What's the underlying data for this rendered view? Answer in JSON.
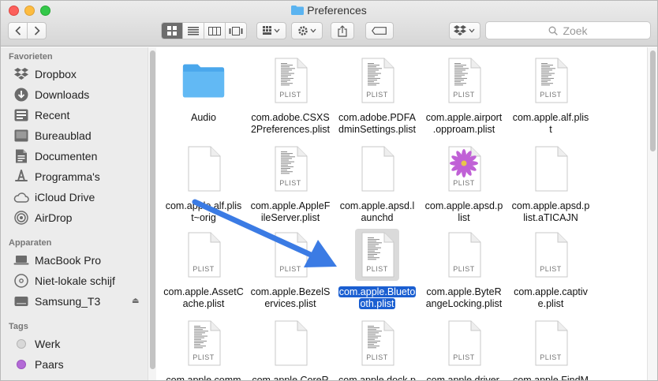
{
  "window": {
    "title": "Preferences"
  },
  "toolbar": {
    "search_placeholder": "Zoek"
  },
  "sidebar": {
    "sections": [
      {
        "label": "Favorieten",
        "items": [
          {
            "label": "Dropbox",
            "icon": "dropbox-icon"
          },
          {
            "label": "Downloads",
            "icon": "download-icon"
          },
          {
            "label": "Recent",
            "icon": "clock-icon"
          },
          {
            "label": "Bureaublad",
            "icon": "desktop-icon"
          },
          {
            "label": "Documenten",
            "icon": "document-icon"
          },
          {
            "label": "Programma's",
            "icon": "applications-icon"
          },
          {
            "label": "iCloud Drive",
            "icon": "cloud-icon"
          },
          {
            "label": "AirDrop",
            "icon": "airdrop-icon"
          }
        ]
      },
      {
        "label": "Apparaten",
        "items": [
          {
            "label": "MacBook Pro",
            "icon": "laptop-icon"
          },
          {
            "label": "Niet-lokale schijf",
            "icon": "disc-icon"
          },
          {
            "label": "Samsung_T3",
            "icon": "drive-icon"
          }
        ]
      },
      {
        "label": "Tags",
        "items": [
          {
            "label": "Werk",
            "color": "#d8d8d8"
          },
          {
            "label": "Paars",
            "color": "#b36ad6"
          }
        ]
      }
    ]
  },
  "files": [
    {
      "line1": "Audio",
      "line2": "",
      "kind": "folder"
    },
    {
      "line1": "com.adobe.CSXS",
      "line2": "2Preferences.plist",
      "kind": "plist-text"
    },
    {
      "line1": "com.adobe.PDFA",
      "line2": "dminSettings.plist",
      "kind": "plist-text"
    },
    {
      "line1": "com.apple.airport",
      "line2": ".opproam.plist",
      "kind": "plist-text"
    },
    {
      "line1": "com.apple.alf.plis",
      "line2": "t",
      "kind": "plist-text"
    },
    {
      "line1": "com.apple.alf.plis",
      "line2": "t~orig",
      "kind": "blank"
    },
    {
      "line1": "com.apple.AppleF",
      "line2": "ileServer.plist",
      "kind": "plist-text"
    },
    {
      "line1": "com.apple.apsd.l",
      "line2": "aunchd",
      "kind": "blank"
    },
    {
      "line1": "com.apple.apsd.p",
      "line2": "list",
      "kind": "plist-flower"
    },
    {
      "line1": "com.apple.apsd.p",
      "line2": "list.aTICAJN",
      "kind": "blank"
    },
    {
      "line1": "com.apple.AssetC",
      "line2": "ache.plist",
      "kind": "plist"
    },
    {
      "line1": "com.apple.BezelS",
      "line2": "ervices.plist",
      "kind": "plist"
    },
    {
      "line1": "com.apple.Blueto",
      "line2": "oth.plist",
      "kind": "plist-text",
      "selected": true
    },
    {
      "line1": "com.apple.ByteR",
      "line2": "angeLocking.plist",
      "kind": "plist"
    },
    {
      "line1": "com.apple.captiv",
      "line2": "e.plist",
      "kind": "plist"
    },
    {
      "line1": "com.apple.comm",
      "line2": "",
      "kind": "plist-text"
    },
    {
      "line1": "com.apple.CoreR",
      "line2": "",
      "kind": "blank"
    },
    {
      "line1": "com.apple.dock.p",
      "line2": "",
      "kind": "plist-text"
    },
    {
      "line1": "com.apple.driver.",
      "line2": "",
      "kind": "plist"
    },
    {
      "line1": "com.apple.FindM",
      "line2": "",
      "kind": "plist"
    }
  ],
  "labels": {
    "plist": "PLIST"
  },
  "colors": {
    "selection": "#1b5fd1",
    "arrow": "#3b7be4",
    "folder": "#5ab3f0"
  }
}
